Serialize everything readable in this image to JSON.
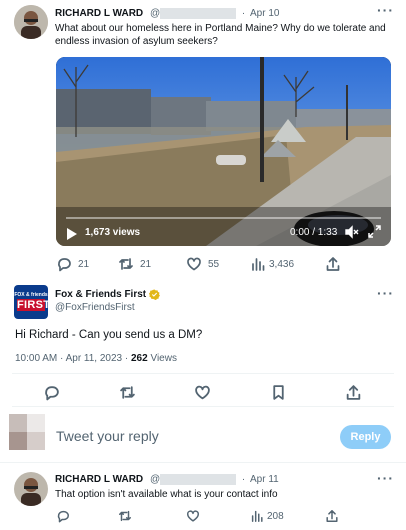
{
  "tweet1": {
    "name": "RICHARD L WARD",
    "handle": "@",
    "date": "Apr 10",
    "text": "What about our homeless here in Portland Maine? Why do we tolerate and endless invasion of asylum seekers?",
    "video": {
      "views": "1,673 views",
      "time": "0:00 / 1:33",
      "progress": 0
    },
    "actions": {
      "replies": "21",
      "retweets": "21",
      "likes": "55",
      "views": "3,436"
    }
  },
  "reply": {
    "name": "Fox & Friends First",
    "handle": "@FoxFriendsFirst",
    "logo_top": "FOX & friends",
    "logo_main": "FIRST",
    "text": "Hi Richard - Can you send us a DM?",
    "meta_time": "10:00 AM · Apr 11, 2023 · ",
    "meta_views_count": "262",
    "meta_views_label": " Views"
  },
  "compose": {
    "placeholder": "Tweet your reply",
    "button": "Reply"
  },
  "tweet3": {
    "name": "RICHARD L WARD",
    "handle": "@",
    "date": "Apr 11",
    "text": "That option isn't available what is your contact info",
    "actions": {
      "views": "208"
    }
  },
  "colors": {
    "accent": "#1d9bf0",
    "reply_button_disabled": "#8ecdf8",
    "verified_gold": "#e2b719"
  }
}
